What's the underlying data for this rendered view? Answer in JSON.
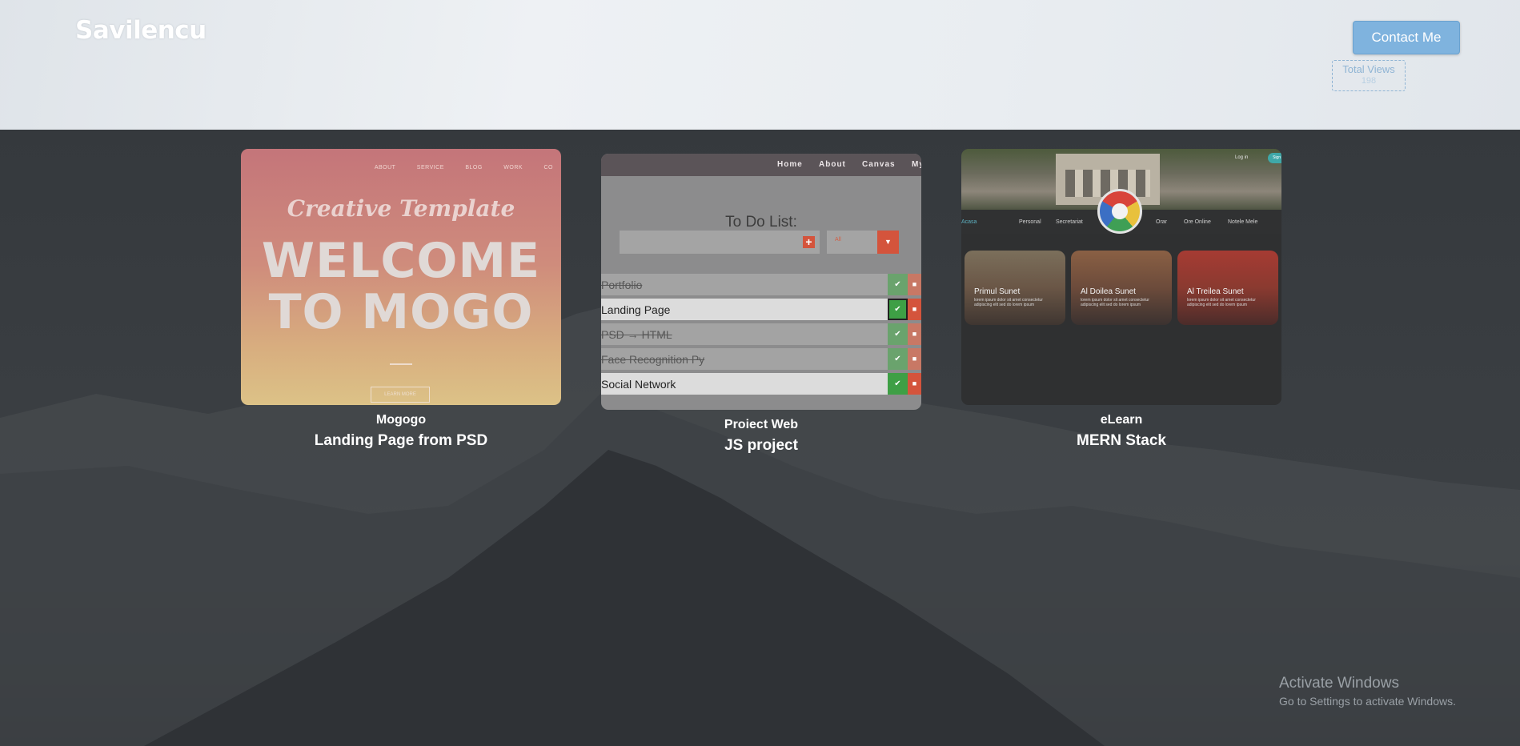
{
  "header": {
    "logo": "Savilencu",
    "contact_label": "Contact Me",
    "views_label": "Total Views",
    "views_count": "198"
  },
  "projects": [
    {
      "name": "Mogogo",
      "title": "Landing Page from PSD",
      "thumb": {
        "nav": [
          "ABOUT",
          "SERVICE",
          "BLOG",
          "WORK",
          "CO"
        ],
        "script": "Creative Template",
        "headline_1": "WELCOME",
        "headline_2": "TO MOGO",
        "button": "LEARN MORE"
      }
    },
    {
      "name": "Proiect Web",
      "title": "JS project",
      "thumb": {
        "nav": [
          "Home",
          "About",
          "Canvas",
          "My"
        ],
        "heading": "To Do List:",
        "filter_value": "All",
        "items": [
          {
            "text": "Portfolio",
            "done": true
          },
          {
            "text": "Landing Page",
            "done": false
          },
          {
            "text": "PSD → HTML",
            "done": true
          },
          {
            "text": "Face Recognition Py",
            "done": true
          },
          {
            "text": "Social Network",
            "done": false
          }
        ]
      }
    },
    {
      "name": "eLearn",
      "title": "MERN Stack",
      "thumb": {
        "login": "Log in",
        "signup": "Sign",
        "nav": [
          "Acasa",
          "Personal",
          "Secretariat",
          "Orar",
          "Ore Online",
          "Notele Mele"
        ],
        "tiles": [
          {
            "title": "Primul Sunet",
            "text": "lorem ipsum dolor sit amet consectetur adipiscing elit sed do lorem ipsum"
          },
          {
            "title": "Al Doilea Sunet",
            "text": "lorem ipsum dolor sit amet consectetur adipiscing elit sed do lorem ipsum"
          },
          {
            "title": "Al Treilea Sunet",
            "text": "lorem ipsum dolor sit amet consectetur adipiscing elit sed do lorem ipsum"
          }
        ]
      }
    }
  ],
  "watermark": {
    "title": "Activate Windows",
    "subtitle": "Go to Settings to activate Windows."
  }
}
